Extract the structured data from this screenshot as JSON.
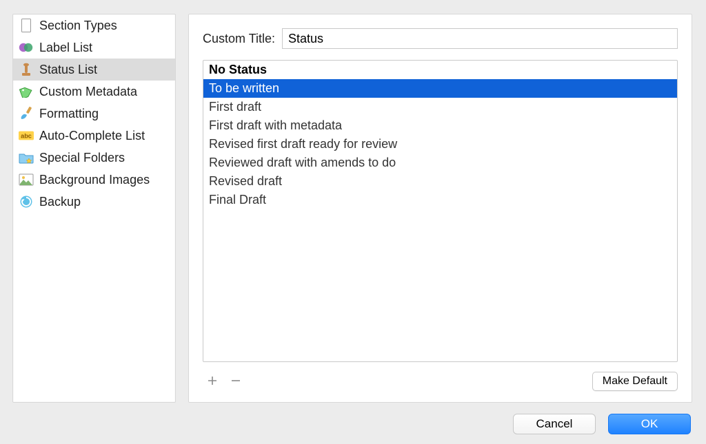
{
  "sidebar": {
    "items": [
      {
        "label": "Section Types",
        "icon": "section-types-icon"
      },
      {
        "label": "Label List",
        "icon": "label-list-icon"
      },
      {
        "label": "Status List",
        "icon": "status-list-icon",
        "selected": true
      },
      {
        "label": "Custom Metadata",
        "icon": "tag-icon"
      },
      {
        "label": "Formatting",
        "icon": "brush-icon"
      },
      {
        "label": "Auto-Complete List",
        "icon": "abc-icon"
      },
      {
        "label": "Special Folders",
        "icon": "folder-star-icon"
      },
      {
        "label": "Background Images",
        "icon": "image-icon"
      },
      {
        "label": "Backup",
        "icon": "backup-icon"
      }
    ]
  },
  "main": {
    "custom_title_label": "Custom Title:",
    "custom_title_value": "Status",
    "header": "No Status",
    "rows": [
      {
        "text": "To be written",
        "selected": true
      },
      {
        "text": "First draft"
      },
      {
        "text": "First draft with metadata"
      },
      {
        "text": "Revised first draft ready for review"
      },
      {
        "text": "Reviewed draft with amends to do"
      },
      {
        "text": "Revised draft"
      },
      {
        "text": "Final Draft"
      }
    ],
    "add_label": "＋",
    "remove_label": "－",
    "make_default_label": "Make Default"
  },
  "footer": {
    "cancel": "Cancel",
    "ok": "OK"
  }
}
